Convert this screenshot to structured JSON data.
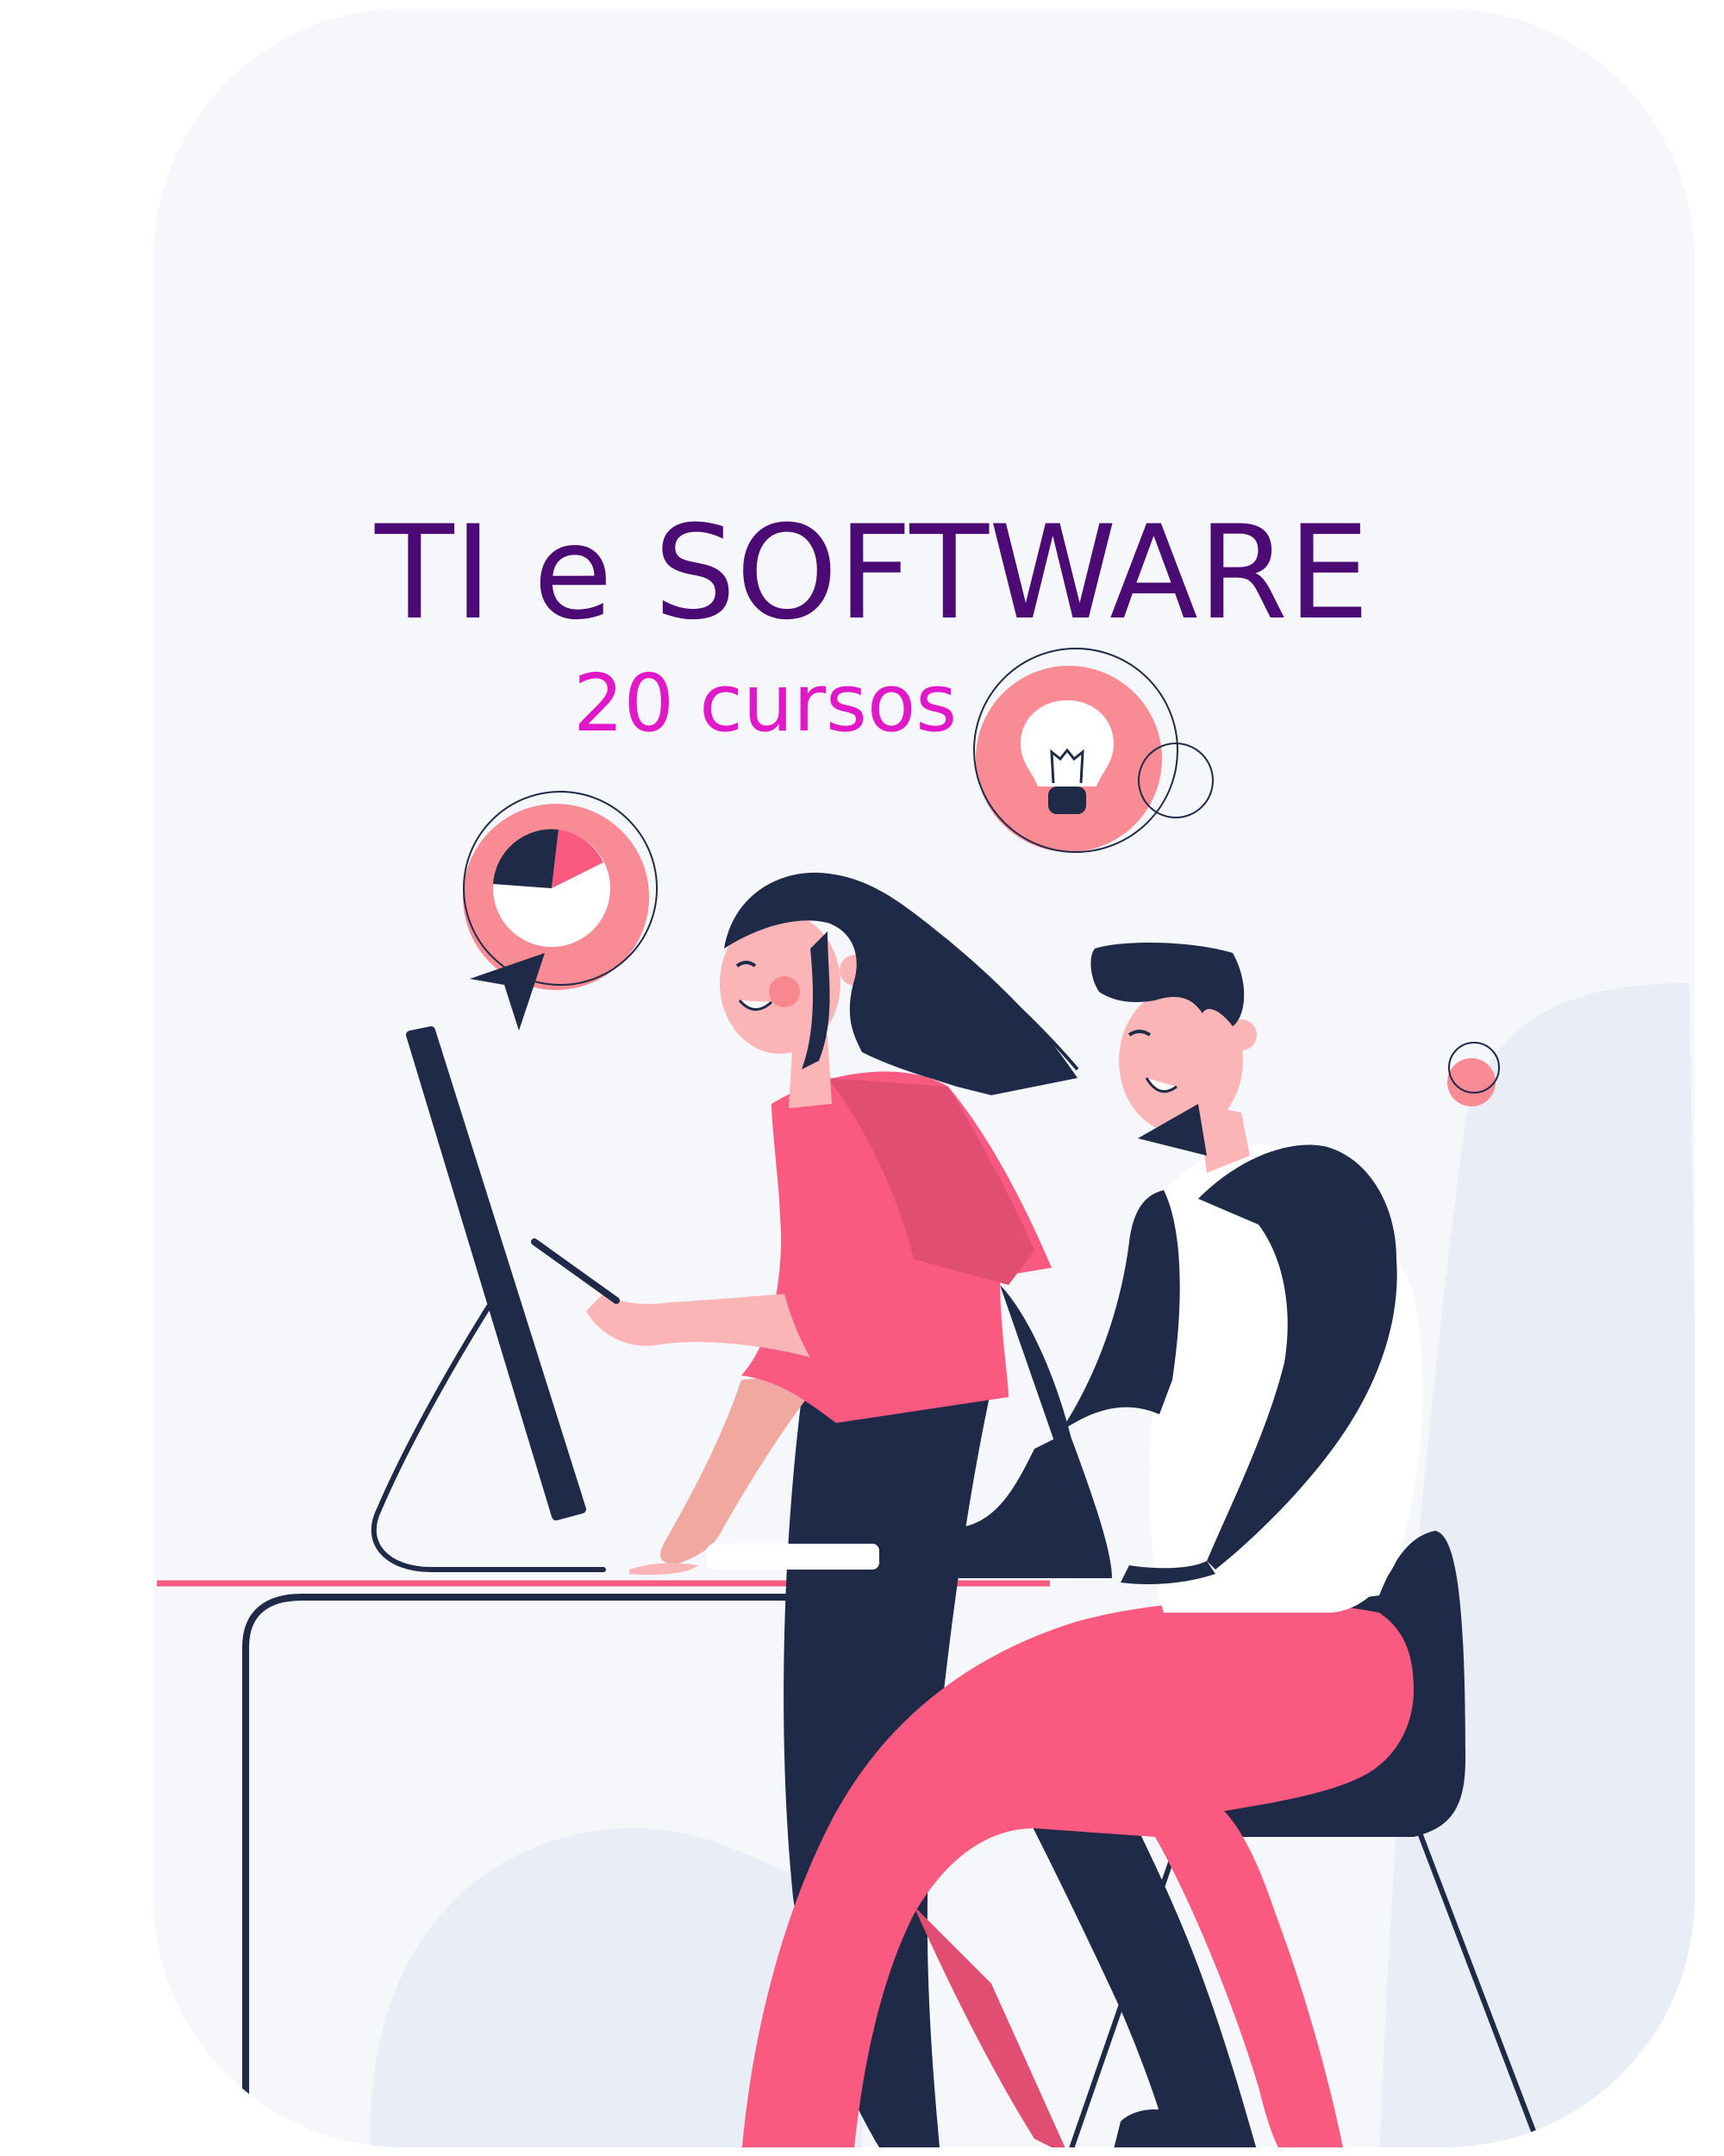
{
  "card": {
    "title": "TI e SOFTWARE",
    "subtitle": "20 cursos"
  },
  "colors": {
    "title": "#4b0a74",
    "subtitle": "#e118c8",
    "pink": "#fb5a80",
    "dark_pink": "#e04e72",
    "navy": "#1f2a48",
    "skin": "#fbb5b6",
    "card_bg": "#f6f7fb"
  },
  "icons": [
    "pie-chart-icon",
    "cursor-arrow-icon",
    "lightbulb-icon"
  ]
}
